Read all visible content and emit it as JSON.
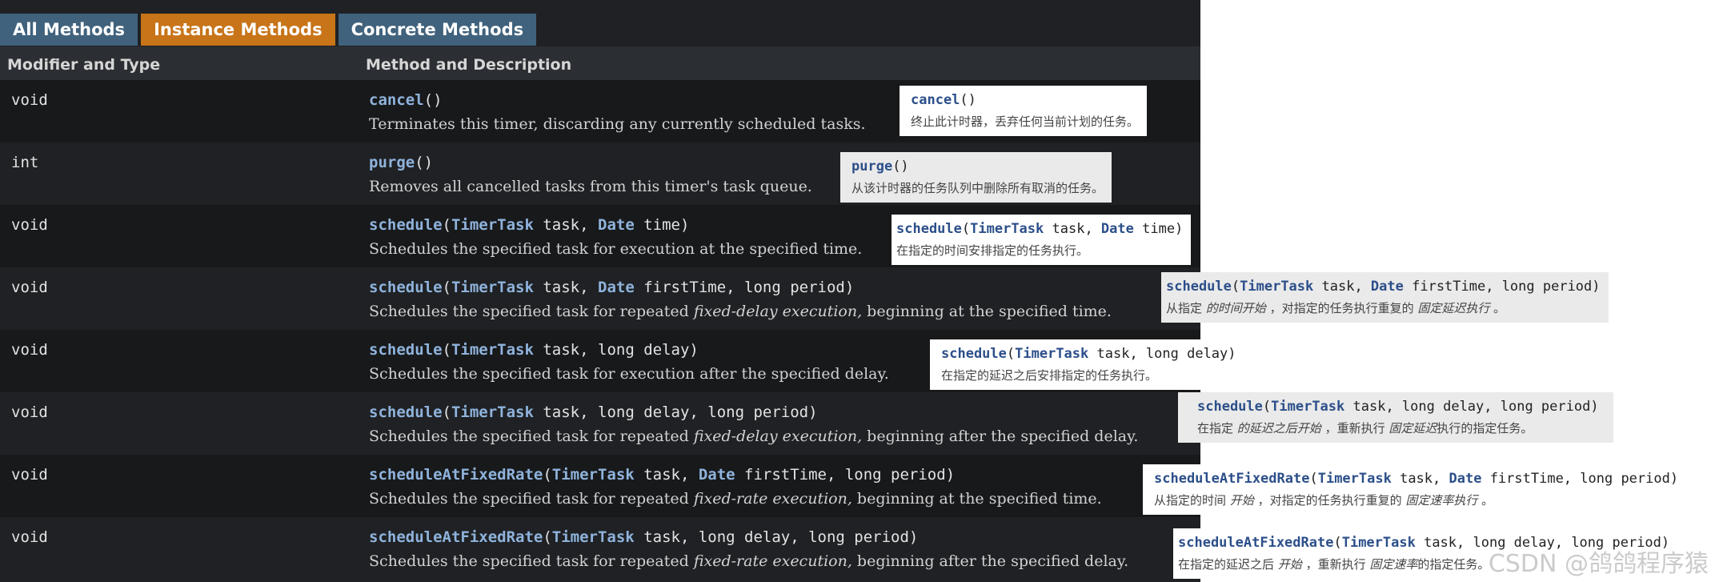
{
  "tabs": {
    "all": "All Methods",
    "instance": "Instance Methods",
    "concrete": "Concrete Methods"
  },
  "header": {
    "col1": "Modifier and Type",
    "col2": "Method and Description"
  },
  "rows": [
    {
      "type": "void",
      "name": "cancel",
      "params_html": "()",
      "desc": "Terminates this timer, discarding any currently scheduled tasks.",
      "ann_sig": "cancel()",
      "ann_text": "终止此计时器，丢弃任何当前计划的任务。"
    },
    {
      "type": "int",
      "name": "purge",
      "desc": "Removes all cancelled tasks from this timer's task queue.",
      "ann_text": "从该计时器的任务队列中删除所有取消的任务。"
    },
    {
      "type": "void",
      "name": "schedule",
      "desc": "Schedules the specified task for execution at the specified time.",
      "ann_text": "在指定的时间安排指定的任务执行。"
    },
    {
      "type": "void",
      "name": "schedule",
      "desc_a": "Schedules the specified task for repeated ",
      "desc_i": "fixed-delay execution,",
      "desc_b": " beginning at the specified time.",
      "ann_text_a": "从指定 ",
      "ann_text_i": "的时间开始",
      "ann_text_b": " ，对指定的任务执行重复的 ",
      "ann_text_i2": "固定延迟执行",
      "ann_text_c": " 。"
    },
    {
      "type": "void",
      "name": "schedule",
      "desc": "Schedules the specified task for execution after the specified delay.",
      "ann_text": "在指定的延迟之后安排指定的任务执行。"
    },
    {
      "type": "void",
      "name": "schedule",
      "desc_a": "Schedules the specified task for repeated ",
      "desc_i": "fixed-delay execution,",
      "desc_b": " beginning after the specified delay.",
      "ann_text_a": "在指定 ",
      "ann_text_i": "的延迟之后开始",
      "ann_text_b": " ，重新执行 ",
      "ann_text_i2": "固定延迟",
      "ann_text_c": "执行的指定任务。"
    },
    {
      "type": "void",
      "name": "scheduleAtFixedRate",
      "desc_a": "Schedules the specified task for repeated ",
      "desc_i": "fixed-rate execution,",
      "desc_b": " beginning at the specified time.",
      "ann_text_a": "从指定的时间 ",
      "ann_text_i": "开始",
      "ann_text_b": " ，对指定的任务执行重复的 ",
      "ann_text_i2": "固定速率执行",
      "ann_text_c": " 。"
    },
    {
      "type": "void",
      "name": "scheduleAtFixedRate",
      "desc_a": "Schedules the specified task for repeated ",
      "desc_i": "fixed-rate execution,",
      "desc_b": " beginning after the specified delay.",
      "ann_text_a": "在指定的延迟之后 ",
      "ann_text_i": "开始",
      "ann_text_b": " ，重新执行 ",
      "ann_text_i2": "固定速率",
      "ann_text_c": "的指定任务。"
    }
  ],
  "sig": {
    "TimerTask": "TimerTask",
    "Date": "Date",
    "task": " task, ",
    "time": " time)",
    "firstTime": " firstTime, long period)",
    "delay": "long delay)",
    "delay_period": "long delay, long period)",
    "open": "(",
    "empty": "()"
  },
  "watermark": "CSDN @鸽鸽程序猿"
}
